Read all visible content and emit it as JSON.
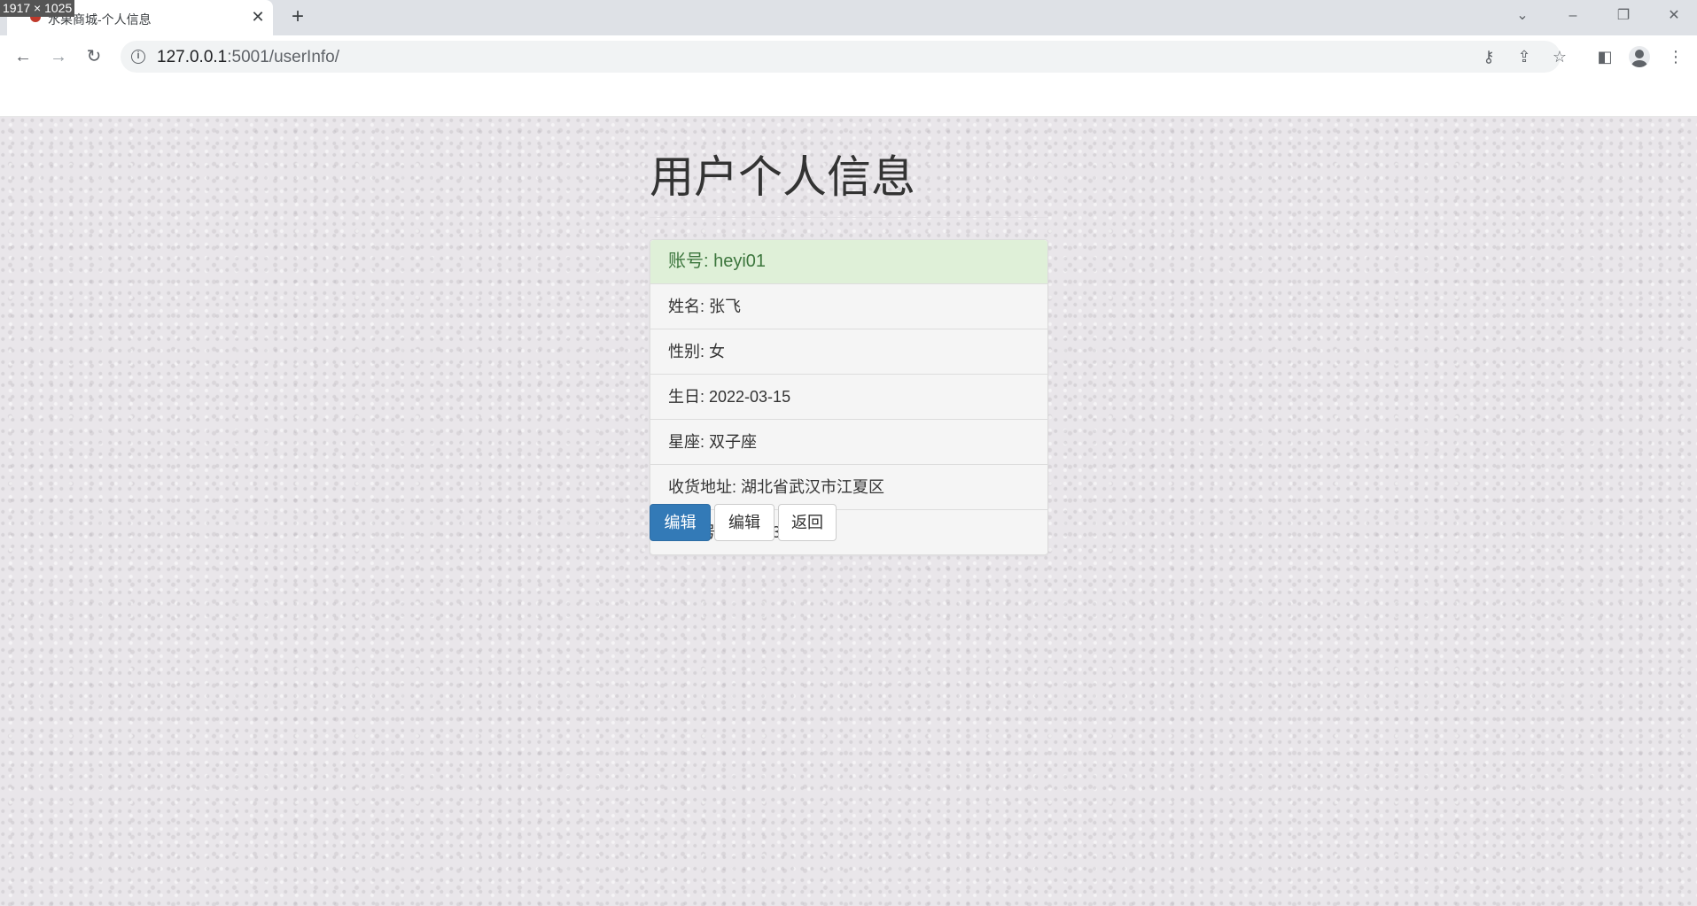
{
  "browser": {
    "tab_title": "水果商城-个人信息",
    "dims_badge": "1917 × 1025",
    "url_host": "127.0.0.1",
    "url_rest": ":5001/userInfo/"
  },
  "page": {
    "title": "用户个人信息",
    "account": "账号: heyi01",
    "fields": [
      "姓名: 张飞",
      "性别: 女",
      "生日: 2022-03-15",
      "星座: 双子座",
      "收货地址: 湖北省武汉市江夏区",
      "手机号码:15623874066"
    ],
    "buttons": {
      "edit_primary": "编辑",
      "edit": "编辑",
      "back": "返回"
    }
  },
  "colors": {
    "primary": "#337ab7",
    "heading_bg": "#dff0d8",
    "heading_text": "#3c763d"
  }
}
